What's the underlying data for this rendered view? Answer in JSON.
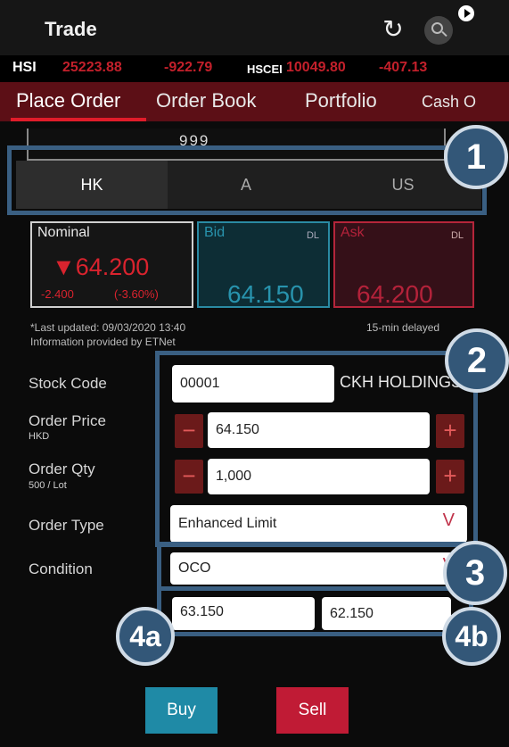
{
  "header": {
    "title": "Trade",
    "refresh_icon": "refresh-icon",
    "search_icon": "search-icon"
  },
  "ticker": {
    "hsi_label": "HSI",
    "hsi_value": "25223.88",
    "hsi_change": "-922.79",
    "hscei_label": "HSCEI",
    "hscei_value": "10049.80",
    "hscei_change": "-407.13"
  },
  "tabs": [
    {
      "label": "Place Order"
    },
    {
      "label": "Order Book"
    },
    {
      "label": "Portfolio"
    },
    {
      "label": "Cash O"
    }
  ],
  "account": {
    "partial_text": "999"
  },
  "markets": [
    {
      "label": "HK"
    },
    {
      "label": "A"
    },
    {
      "label": "US"
    }
  ],
  "quote": {
    "nominal_label": "Nominal",
    "nominal_price": "▼64.200",
    "nominal_change": "-2.400",
    "nominal_change_pct": "(-3.60%)",
    "bid_label": "Bid",
    "bid_dl": "DL",
    "bid_price": "64.150",
    "ask_label": "Ask",
    "ask_dl": "DL",
    "ask_price": "64.200",
    "last_updated": "*Last updated: 09/03/2020 13:40",
    "provider": "Information provided by ETNet",
    "delay_note": "15-min delayed"
  },
  "form": {
    "stock_code_label": "Stock Code",
    "stock_code_value": "00001",
    "stock_name": "CKH HOLDINGS",
    "order_price_label": "Order Price",
    "order_price_currency": "HKD",
    "order_price_value": "64.150",
    "order_qty_label": "Order Qty",
    "order_qty_lot": "500 / Lot",
    "order_qty_value": "1,000",
    "order_type_label": "Order Type",
    "order_type_value": "Enhanced Limit",
    "chevron": "V",
    "condition_label": "Condition",
    "condition_value": "OCO",
    "trigger_price_a": "63.150",
    "trigger_price_b": "62.150",
    "minus": "−",
    "plus": "+"
  },
  "badges": {
    "b1": "1",
    "b2": "2",
    "b3": "3",
    "b4a": "4a",
    "b4b": "4b"
  },
  "buttons": {
    "buy": "Buy",
    "sell": "Sell"
  },
  "colors": {
    "accent_red": "#c01b35",
    "bid_teal": "#1f8aa6",
    "annotation_blue": "#335778",
    "tab_bar": "#5c0f16"
  }
}
